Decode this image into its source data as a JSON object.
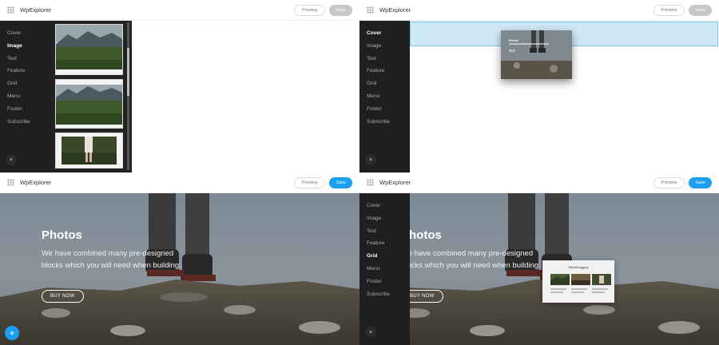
{
  "app": {
    "brand": "WpExplorer",
    "preview_label": "Preview",
    "save_label": "Save"
  },
  "sidebar": {
    "items": [
      "Cover",
      "Image",
      "Text",
      "Feature",
      "Grid",
      "Menu",
      "Footer",
      "Subscribe"
    ],
    "close_glyph": "×"
  },
  "panel1": {
    "active_item": "Image",
    "save_state": "disabled"
  },
  "panel2": {
    "active_item": "Cover",
    "save_state": "disabled",
    "drag_card": {
      "title": "Photos"
    }
  },
  "panel3": {
    "save_state": "active"
  },
  "panel4": {
    "active_item": "Grid",
    "save_state": "active",
    "grid_card": {
      "title": "Microblogging"
    }
  },
  "hero": {
    "title": "Photos",
    "body": "We have combined many pre-designed blocks which you will need when building.",
    "button": "BUY NOW"
  },
  "fab": {
    "glyph": "+"
  },
  "colors": {
    "accent": "#1b9ff0",
    "sidebar": "#1f1f21",
    "drop_zone": "#cfe8f6"
  },
  "icons": [
    "grid-icon",
    "close-icon",
    "plus-icon"
  ]
}
